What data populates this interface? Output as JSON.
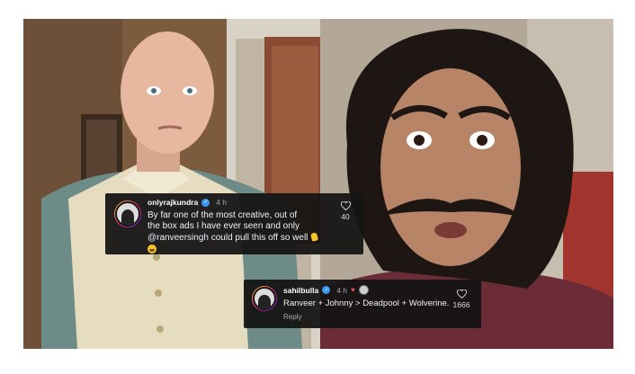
{
  "comments": [
    {
      "username": "onlyrajkundra",
      "verified": true,
      "time": "4 h",
      "text_lines": [
        "By far one of the most creative, out of",
        "the box ads I have ever seen and only"
      ],
      "mention": "@ranveersingh",
      "text_after_mention": " could pull this off so well",
      "emojis": [
        "clapping-hands",
        "grinning-face"
      ],
      "like_count": "40",
      "icon": "heart-outline-icon"
    },
    {
      "username": "sahilbulla",
      "verified": true,
      "time": "4 h",
      "creator_liked": true,
      "text": "Ranveer + Johnny > Deadpool + Wolverine.",
      "reply_label": "Reply",
      "like_count": "1666",
      "icon": "heart-outline-icon"
    }
  ],
  "colors": {
    "comment_bg": "#141414",
    "verified_badge": "#3897f0",
    "creator_heart": "#ed4956",
    "meta_text": "#a8a8a8"
  }
}
